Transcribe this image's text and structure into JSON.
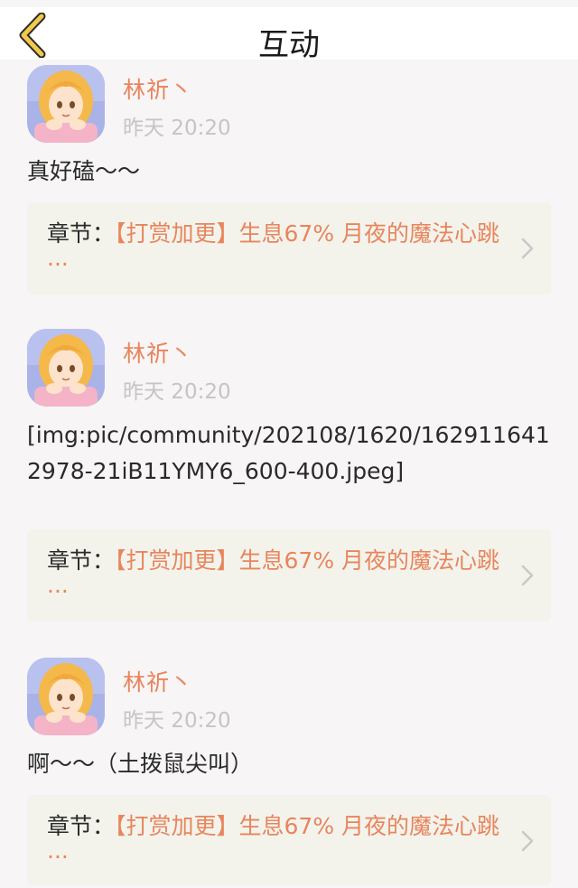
{
  "header": {
    "title": "互动",
    "back_icon": "chevron-left-icon"
  },
  "posts": [
    {
      "username": "林祈丶",
      "time": "昨天 20:20",
      "content": "真好磕～～",
      "chapter": {
        "label": "章节：",
        "name": "【打赏加更】生息67% 月夜的魔法心跳···"
      }
    },
    {
      "username": "林祈丶",
      "time": "昨天 20:20",
      "content": "[img:pic/community/202108/1620/1629116412978-21iB11YMY6_600-400.jpeg]",
      "chapter": {
        "label": "章节：",
        "name": "【打赏加更】生息67% 月夜的魔法心跳···"
      }
    },
    {
      "username": "林祈丶",
      "time": "昨天 20:20",
      "content": "啊～～（土拨鼠尖叫）",
      "chapter": {
        "label": "章节：",
        "name": "【打赏加更】生息67% 月夜的魔法心跳···"
      }
    }
  ],
  "colors": {
    "accent": "#e8855c",
    "back_arrow": "#f2c94c",
    "chapter_bg": "#f3f3ec",
    "time": "#c5c5c5"
  }
}
